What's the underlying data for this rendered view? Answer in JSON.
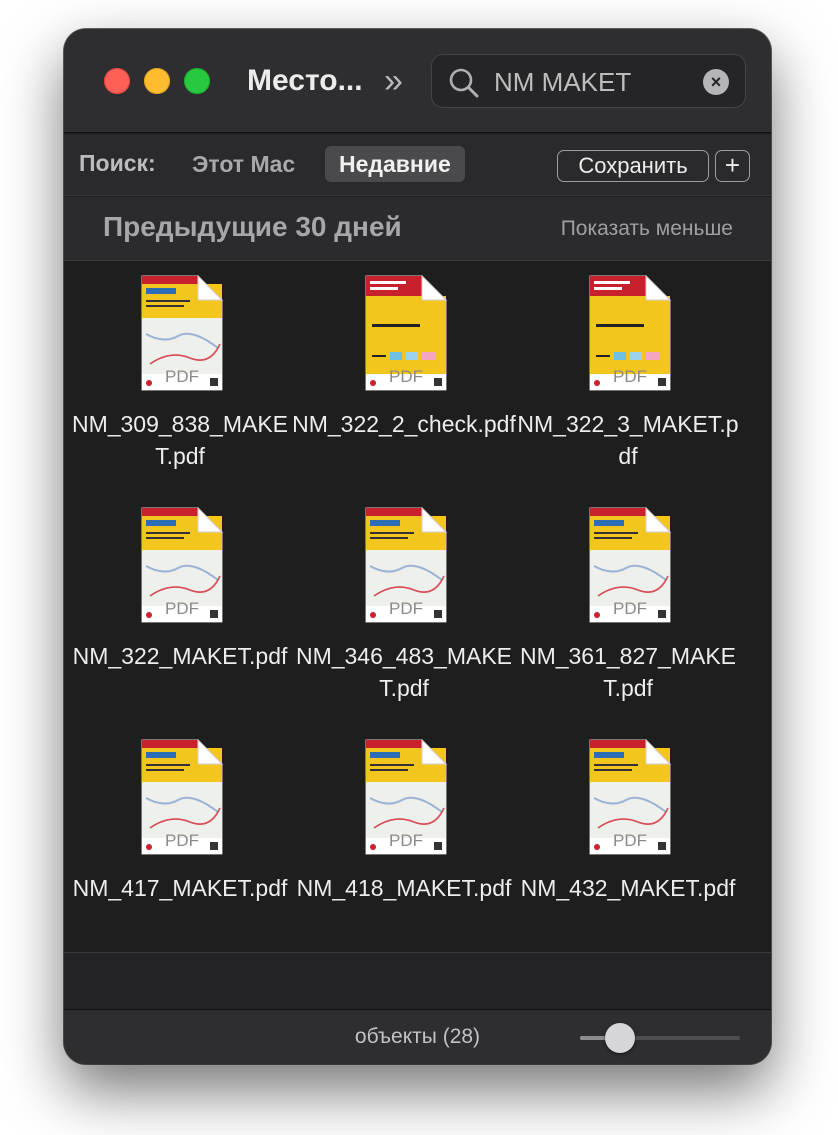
{
  "window": {
    "title": "Место...",
    "chevron": "»",
    "search": {
      "value": "NM MAKET",
      "placeholder": "Поиск",
      "clear_icon": "×"
    }
  },
  "scope": {
    "label": "Поиск:",
    "this_mac": "Этот Mac",
    "recent": "Недавние",
    "save": "Сохранить",
    "add": "+"
  },
  "section": {
    "title": "Предыдущие 30 дней",
    "toggle": "Показать меньше"
  },
  "files": [
    {
      "name": "NM_309_838_MAKET.pdf",
      "badge": "PDF",
      "variant": "route-map"
    },
    {
      "name": "NM_322_2_check.pdf",
      "badge": "PDF",
      "variant": "red-header"
    },
    {
      "name": "NM_322_3_MAKET.pdf",
      "badge": "PDF",
      "variant": "red-header"
    },
    {
      "name": "NM_322_MAKET.pdf",
      "badge": "PDF",
      "variant": "route-map"
    },
    {
      "name": "NM_346_483_MAKET.pdf",
      "badge": "PDF",
      "variant": "route-map"
    },
    {
      "name": "NM_361_827_MAKET.pdf",
      "badge": "PDF",
      "variant": "route-map"
    },
    {
      "name": "NM_417_MAKET.pdf",
      "badge": "PDF",
      "variant": "route-map"
    },
    {
      "name": "NM_418_MAKET.pdf",
      "badge": "PDF",
      "variant": "route-map"
    },
    {
      "name": "NM_432_MAKET.pdf",
      "badge": "PDF",
      "variant": "route-map"
    }
  ],
  "status": {
    "text": "объекты (28)",
    "zoom_level": 0.25
  },
  "colors": {
    "red": "#fe5f57",
    "yellow": "#febc2e",
    "green": "#28c840",
    "doc_yellow": "#f3c61d",
    "doc_red": "#c8202c"
  }
}
